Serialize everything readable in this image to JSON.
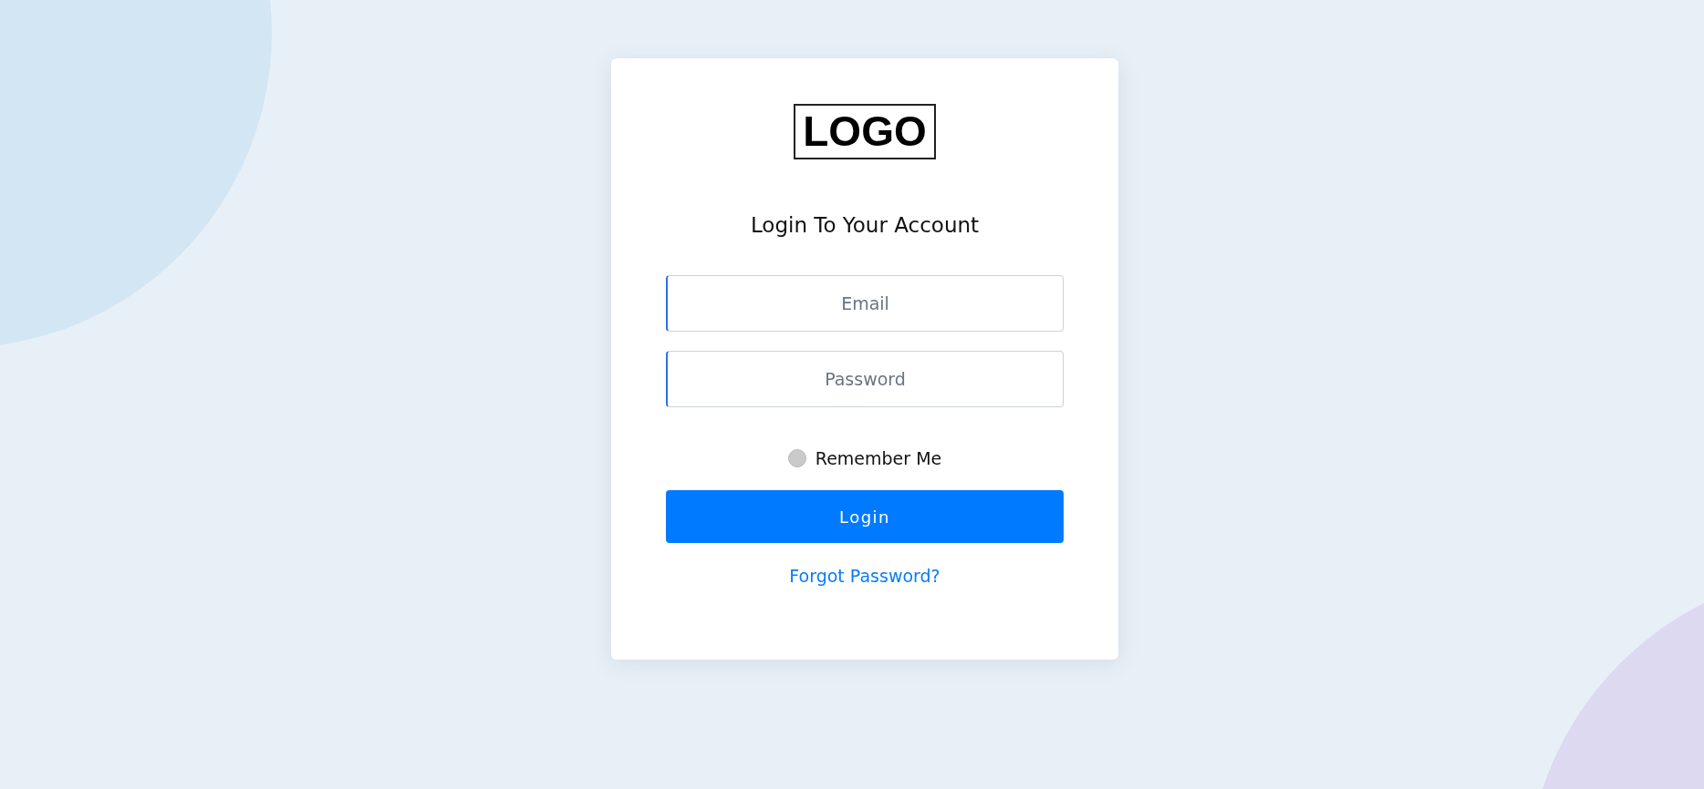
{
  "logo": "LOGO",
  "title": "Login To Your Account",
  "fields": [
    {
      "placeholder": "Email"
    },
    {
      "placeholder": "Password"
    }
  ],
  "remember_me": {
    "label": "Remember Me",
    "checked": false
  },
  "login_button": "Login",
  "forgot_link": "Forgot Password?"
}
